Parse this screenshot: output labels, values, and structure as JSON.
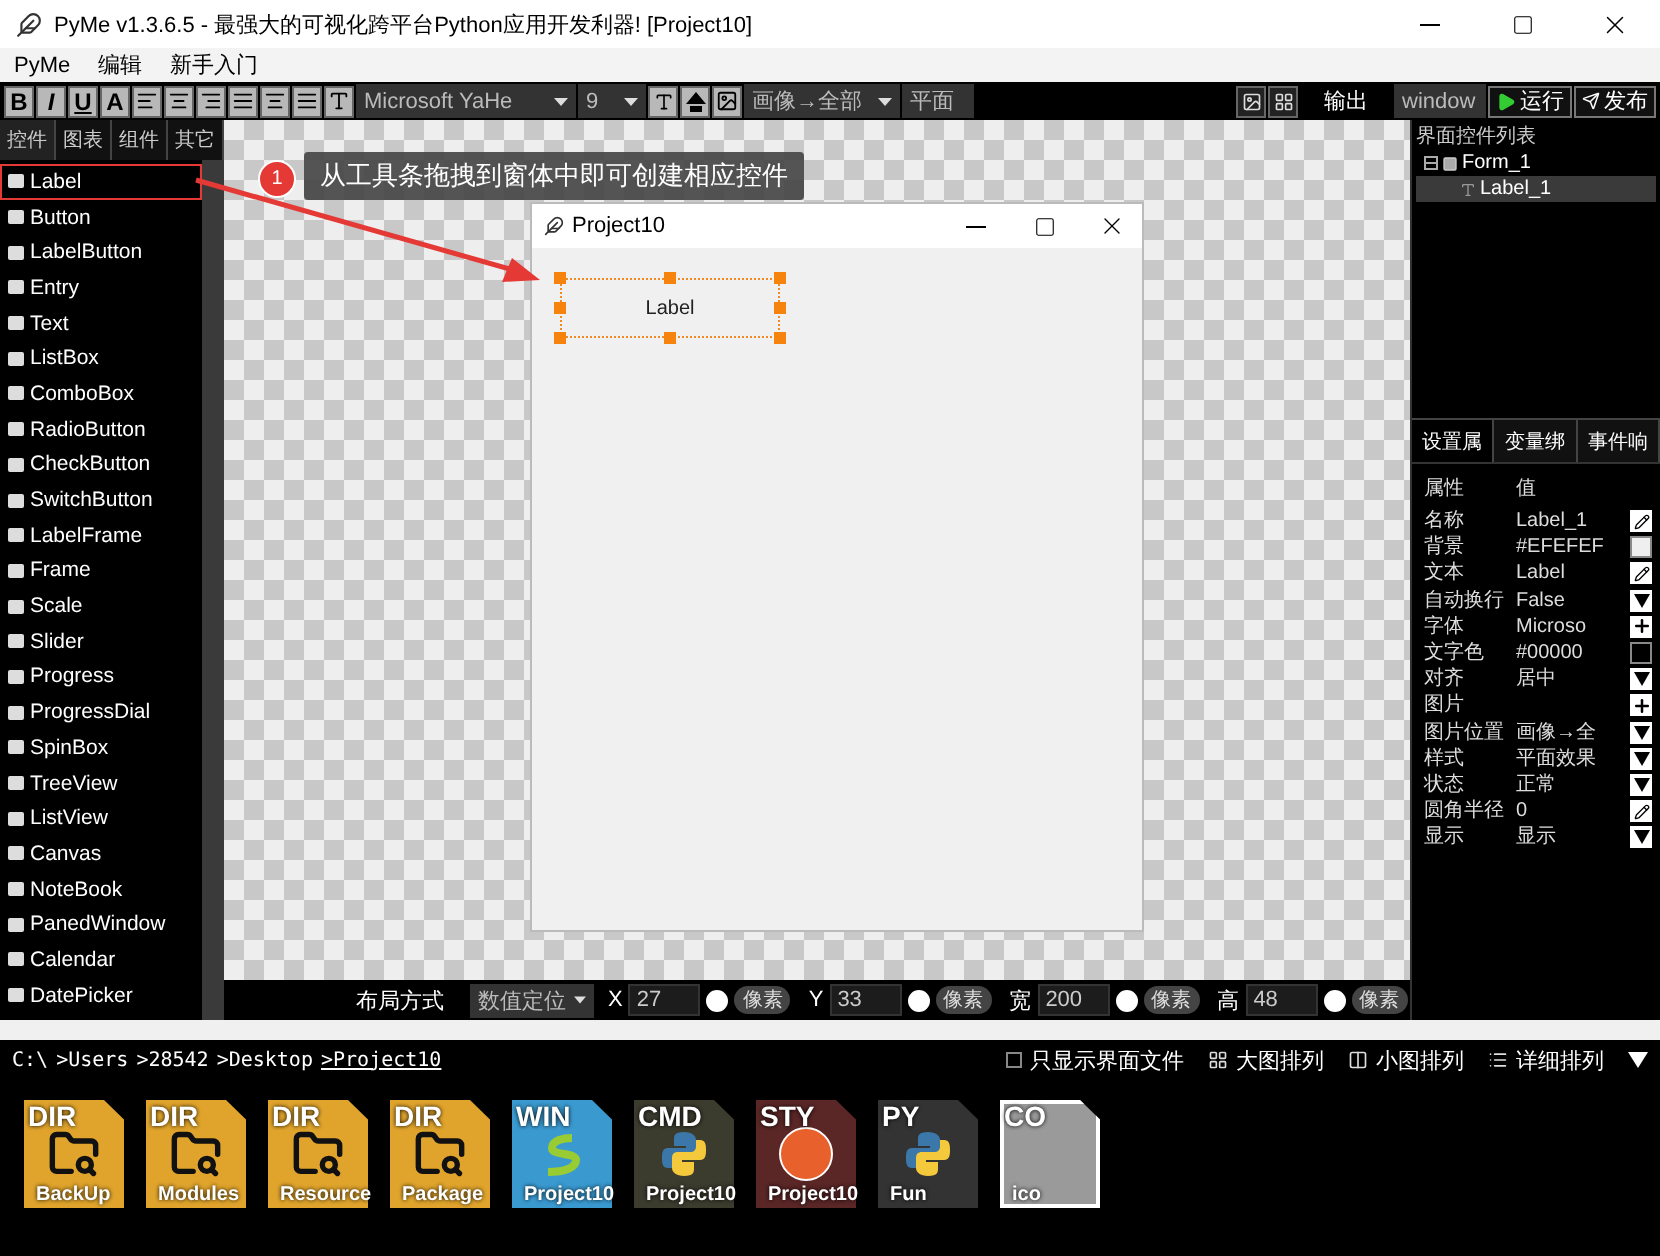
{
  "title_bar": {
    "title": "PyMe v1.3.6.5 -  最强大的可视化跨平台Python应用开发利器!   [Project10]"
  },
  "menu": [
    "PyMe",
    "编辑",
    "新手入门"
  ],
  "toolbar": {
    "format_buttons": [
      "B",
      "I",
      "U",
      "A"
    ],
    "font": "Microsoft YaHe",
    "size": "9",
    "image_position": "画像→全部",
    "style": "平面",
    "output_label": "输出",
    "target": "window",
    "run": "运行",
    "publish": "发布"
  },
  "palette": {
    "tabs": [
      {
        "label": "控件",
        "selected": true
      },
      {
        "label": "图表",
        "selected": false
      },
      {
        "label": "组件",
        "selected": false
      },
      {
        "label": "其它",
        "selected": false
      }
    ],
    "items": [
      {
        "label": "Label",
        "selected": true
      },
      {
        "label": "Button",
        "selected": false
      },
      {
        "label": "LabelButton",
        "selected": false
      },
      {
        "label": "Entry",
        "selected": false
      },
      {
        "label": "Text",
        "selected": false
      },
      {
        "label": "ListBox",
        "selected": false
      },
      {
        "label": "ComboBox",
        "selected": false
      },
      {
        "label": "RadioButton",
        "selected": false
      },
      {
        "label": "CheckButton",
        "selected": false
      },
      {
        "label": "SwitchButton",
        "selected": false
      },
      {
        "label": "LabelFrame",
        "selected": false
      },
      {
        "label": "Frame",
        "selected": false
      },
      {
        "label": "Scale",
        "selected": false
      },
      {
        "label": "Slider",
        "selected": false
      },
      {
        "label": "Progress",
        "selected": false
      },
      {
        "label": "ProgressDial",
        "selected": false
      },
      {
        "label": "SpinBox",
        "selected": false
      },
      {
        "label": "TreeView",
        "selected": false
      },
      {
        "label": "ListView",
        "selected": false
      },
      {
        "label": "Canvas",
        "selected": false
      },
      {
        "label": "NoteBook",
        "selected": false
      },
      {
        "label": "PanedWindow",
        "selected": false
      },
      {
        "label": "Calendar",
        "selected": false
      },
      {
        "label": "DatePicker",
        "selected": false
      }
    ]
  },
  "tutorial": {
    "step": "1",
    "tip": "从工具条拖拽到窗体中即可创建相应控件"
  },
  "form": {
    "title": "Project10",
    "label": "Label"
  },
  "layout_bar": {
    "label": "布局方式",
    "mode": "数值定位",
    "fields": [
      {
        "axis": "X",
        "value": "27",
        "unit": "像素",
        "selected": false
      },
      {
        "axis": "Y",
        "value": "33",
        "unit": "像素",
        "selected": false
      },
      {
        "axis": "宽",
        "value": "200",
        "unit": "像素",
        "selected": false
      },
      {
        "axis": "高",
        "value": "48",
        "unit": "像素",
        "selected": false
      }
    ]
  },
  "tree": {
    "title": "界面控件列表",
    "nodes": [
      {
        "label": "Form_1",
        "expanded": true,
        "selected": false,
        "children": [
          {
            "label": "Label_1",
            "selected": true
          }
        ]
      }
    ]
  },
  "properties": {
    "tabs": [
      {
        "label": "设置属",
        "selected": true
      },
      {
        "label": "变量绑",
        "selected": false
      },
      {
        "label": "事件响",
        "selected": false
      }
    ],
    "columns": [
      "属性",
      "值"
    ],
    "rows": [
      {
        "name": "名称",
        "value": "Label_1",
        "kind": "edit"
      },
      {
        "name": "背景",
        "value": "#EFEFEF",
        "kind": "swatch",
        "color": "#efefef"
      },
      {
        "name": "文本",
        "value": "Label",
        "kind": "edit"
      },
      {
        "name": "自动换行",
        "value": "False",
        "kind": "dropdown"
      },
      {
        "name": "字体",
        "value": "Microso",
        "kind": "add"
      },
      {
        "name": "文字色",
        "value": "#00000",
        "kind": "swatch",
        "color": "#000000"
      },
      {
        "name": "对齐",
        "value": "居中",
        "kind": "dropdown"
      },
      {
        "name": "图片",
        "value": "",
        "kind": "add"
      },
      {
        "name": "图片位置",
        "value": "画像→全",
        "kind": "dropdown"
      },
      {
        "name": "样式",
        "value": "平面效果",
        "kind": "dropdown"
      },
      {
        "name": "状态",
        "value": "正常",
        "kind": "dropdown"
      },
      {
        "name": "圆角半径",
        "value": "0",
        "kind": "edit"
      },
      {
        "name": "显示",
        "value": "显示",
        "kind": "dropdown"
      }
    ]
  },
  "files": {
    "path": [
      {
        "label": "C:\\",
        "current": false
      },
      {
        "label": ">Users",
        "current": false
      },
      {
        "label": ">28542",
        "current": false
      },
      {
        "label": ">Desktop",
        "current": false
      },
      {
        "label": ">Project10",
        "current": true
      }
    ],
    "only_ui": {
      "label": "只显示界面文件",
      "checked": false
    },
    "views": [
      {
        "label": "大图排列",
        "kind": "grid"
      },
      {
        "label": "小图排列",
        "kind": "columns"
      },
      {
        "label": "详细排列",
        "kind": "list"
      }
    ],
    "items": [
      {
        "tag": "DIR",
        "name": "BackUp",
        "color": "#e0a42c"
      },
      {
        "tag": "DIR",
        "name": "Modules",
        "color": "#e0a42c"
      },
      {
        "tag": "DIR",
        "name": "Resource",
        "color": "#e0a42c"
      },
      {
        "tag": "DIR",
        "name": "Package",
        "color": "#e0a42c"
      },
      {
        "tag": "WIN",
        "name": "Project10",
        "color": "#3a9ad0"
      },
      {
        "tag": "CMD",
        "name": "Project10",
        "color": "#3b3b2e"
      },
      {
        "tag": "STY",
        "name": "Project10",
        "color": "#5a2626"
      },
      {
        "tag": "PY",
        "name": "Fun",
        "color": "#333333"
      },
      {
        "tag": "CO",
        "name": "ico",
        "color": "#9a9a9a"
      }
    ]
  }
}
